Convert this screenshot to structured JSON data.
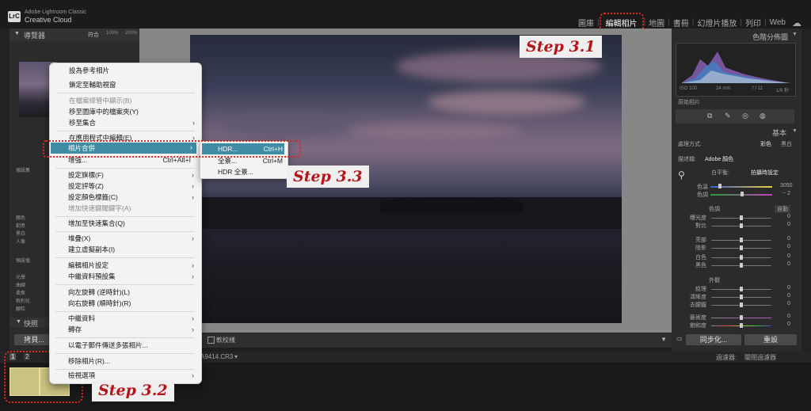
{
  "app": {
    "logo": "LrC",
    "brand_line1": "Adobe Lightroom Classic",
    "brand_line2": "Creative Cloud"
  },
  "modules": [
    "圖庫",
    "編輯相片",
    "地圖",
    "書冊",
    "幻燈片播放",
    "列印",
    "Web"
  ],
  "active_module": "編輯相片",
  "left_panel": {
    "navigator_title": "導覽器",
    "zoom_options": [
      "符合",
      "100%",
      "200%"
    ],
    "side_items": [
      "預設集",
      "顏色",
      "創意",
      "黑白",
      "人像",
      "預設值",
      "光學",
      "曲線",
      "柔焦",
      "銳利化",
      "顆粒"
    ],
    "snapshot_title": "快照",
    "copy_button": "拷貝..."
  },
  "context_menu": {
    "items": [
      {
        "label": "設為參考相片",
        "shortcut": "",
        "submenu": false,
        "disabled": false
      },
      {
        "label": "鎖定至輔助視窗",
        "shortcut": "",
        "submenu": false,
        "disabled": false
      },
      {
        "label": "在檔案總管中顯示(B)",
        "shortcut": "",
        "submenu": false,
        "disabled": true
      },
      {
        "label": "移至圖庫中的檔案夾(Y)",
        "shortcut": "",
        "submenu": false,
        "disabled": false
      },
      {
        "label": "移至集合",
        "shortcut": "",
        "submenu": true,
        "disabled": false
      },
      {
        "label": "在應用程式中編輯(E)",
        "shortcut": "",
        "submenu": true,
        "disabled": false
      },
      {
        "label": "相片合併",
        "shortcut": "",
        "submenu": true,
        "disabled": false,
        "highlighted": true
      },
      {
        "label": "增強...",
        "shortcut": "Ctrl+Alt+I",
        "submenu": false,
        "disabled": false
      },
      {
        "label": "設定旗標(F)",
        "shortcut": "",
        "submenu": true,
        "disabled": false
      },
      {
        "label": "設定評等(Z)",
        "shortcut": "",
        "submenu": true,
        "disabled": false
      },
      {
        "label": "設定顏色標籤(C)",
        "shortcut": "",
        "submenu": true,
        "disabled": false
      },
      {
        "label": "增加快速鍵關鍵字(A)",
        "shortcut": "",
        "submenu": false,
        "disabled": true
      },
      {
        "label": "增加至快速集合(Q)",
        "shortcut": "",
        "submenu": false,
        "disabled": false
      },
      {
        "label": "堆疊(X)",
        "shortcut": "",
        "submenu": true,
        "disabled": false
      },
      {
        "label": "建立虛擬副本(I)",
        "shortcut": "",
        "submenu": false,
        "disabled": false
      },
      {
        "label": "編輯相片設定",
        "shortcut": "",
        "submenu": true,
        "disabled": false
      },
      {
        "label": "中繼資料預設集",
        "shortcut": "",
        "submenu": true,
        "disabled": false
      },
      {
        "label": "向左旋轉 (逆時針)(L)",
        "shortcut": "",
        "submenu": false,
        "disabled": false
      },
      {
        "label": "向右旋轉 (順時針)(R)",
        "shortcut": "",
        "submenu": false,
        "disabled": false
      },
      {
        "label": "中繼資料",
        "shortcut": "",
        "submenu": true,
        "disabled": false
      },
      {
        "label": "轉存",
        "shortcut": "",
        "submenu": true,
        "disabled": false
      },
      {
        "label": "以電子郵件傳送多張相片...",
        "shortcut": "",
        "submenu": false,
        "disabled": false
      },
      {
        "label": "移除相片(R)...",
        "shortcut": "",
        "submenu": false,
        "disabled": false
      },
      {
        "label": "檢視選項",
        "shortcut": "",
        "submenu": true,
        "disabled": false
      }
    ]
  },
  "submenu": {
    "items": [
      {
        "label": "HDR...",
        "shortcut": "Ctrl+H",
        "highlighted": true
      },
      {
        "label": "全景...",
        "shortcut": "Ctrl+M",
        "highlighted": false
      },
      {
        "label": "HDR 全景...",
        "shortcut": "",
        "highlighted": false
      }
    ]
  },
  "steps": {
    "s31": "Step 3.1",
    "s32": "Step 3.2",
    "s33": "Step 3.3"
  },
  "right_panel": {
    "histogram_title": "色階分佈圖",
    "histogram_info": [
      "ISO 100",
      "24 mm",
      "f / 11",
      "1/6 秒"
    ],
    "original_photo_label": "原始相片",
    "basic_title": "基本",
    "treatment_label": "處理方式:",
    "treatment_color": "彩色",
    "treatment_bw": "黑白",
    "profile_label": "描述檔:",
    "profile_value": "Adobe 顏色",
    "wb_label": "白平衡:",
    "wb_value": "拍攝時設定",
    "temp_label": "色溫",
    "temp_value": "3050",
    "tint_label": "色調",
    "tint_value": "− 2",
    "tone_label": "色調",
    "auto_label": "自動",
    "tone_sliders": [
      {
        "label": "曝光度",
        "value": "0"
      },
      {
        "label": "對比",
        "value": "0"
      },
      {
        "label": "亮部",
        "value": "0"
      },
      {
        "label": "陰影",
        "value": "0"
      },
      {
        "label": "白色",
        "value": "0"
      },
      {
        "label": "黑色",
        "value": "0"
      }
    ],
    "presence_label": "外觀",
    "presence_sliders": [
      {
        "label": "紋理",
        "value": "0"
      },
      {
        "label": "清晰度",
        "value": "0"
      },
      {
        "label": "去朦朧",
        "value": "0"
      },
      {
        "label": "藝術度",
        "value": "0"
      },
      {
        "label": "飽和度",
        "value": "0"
      }
    ],
    "sync_button": "同步化...",
    "reset_button": "重設"
  },
  "toolbar": {
    "softproof_label": "軟校樣"
  },
  "filmstrip_bar": {
    "page1": "1",
    "page2": "2",
    "filename": "A9414.CR3",
    "filter_label": "過濾器:",
    "filter_value": "關閉過濾器"
  }
}
